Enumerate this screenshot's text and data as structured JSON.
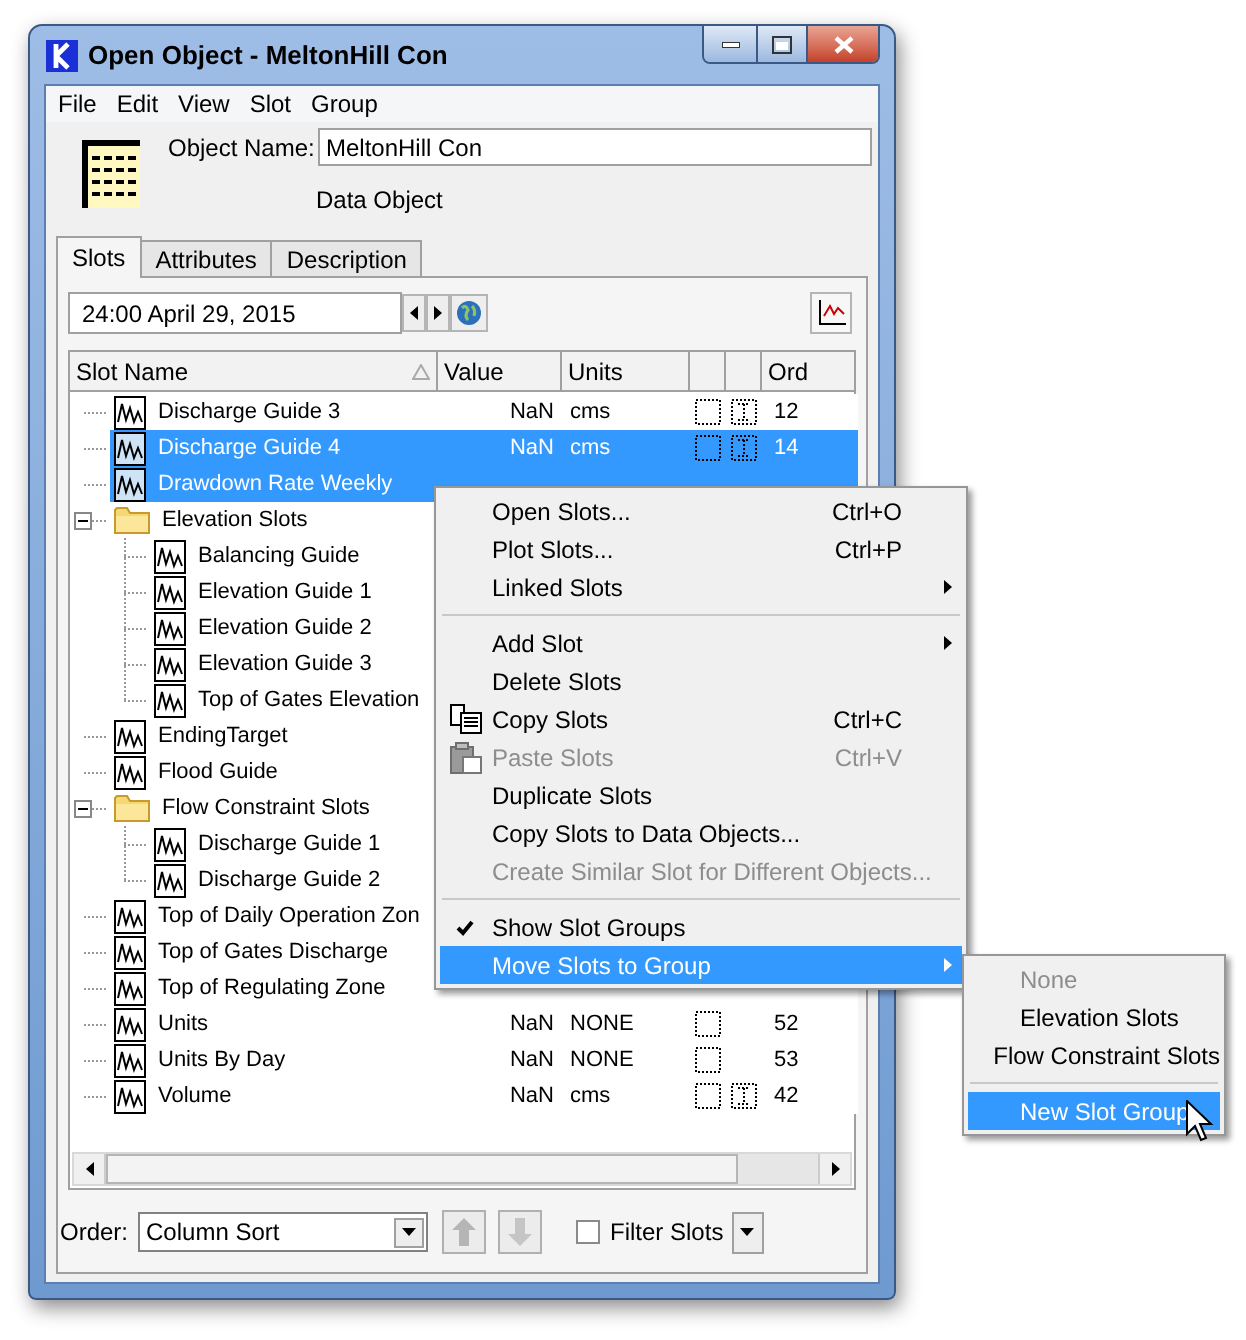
{
  "window": {
    "title": "Open Object - MeltonHill Con"
  },
  "menu_bar": [
    "File",
    "Edit",
    "View",
    "Slot",
    "Group"
  ],
  "object": {
    "name_label": "Object Name:",
    "name_value": "MeltonHill Con",
    "type": "Data Object"
  },
  "tabs": [
    {
      "label": "Slots",
      "selected": true
    },
    {
      "label": "Attributes",
      "selected": false
    },
    {
      "label": "Description",
      "selected": false
    }
  ],
  "timestep": {
    "value": "24:00 April 29, 2015"
  },
  "table": {
    "columns": [
      {
        "label": "Slot Name",
        "sorted": true
      },
      {
        "label": "Value",
        "sorted": false
      },
      {
        "label": "Units",
        "sorted": false
      },
      {
        "label": "Ord",
        "sorted": false
      }
    ],
    "rows": [
      {
        "kind": "slot",
        "name": "Discharge Guide 3",
        "selected": false,
        "value": "NaN",
        "units": "cms",
        "column_4": true,
        "column_5": true,
        "ord": "12"
      },
      {
        "kind": "slot",
        "name": "Discharge Guide 4",
        "selected": true,
        "value": "NaN",
        "units": "cms",
        "column_4": true,
        "column_5": true,
        "ord": "14"
      },
      {
        "kind": "slot",
        "name": "Drawdown Rate Weekly",
        "selected": true
      },
      {
        "kind": "folder",
        "name": "Elevation Slots",
        "selected": false,
        "expanded": true,
        "children": [
          {
            "kind": "slot",
            "name": "Balancing Guide",
            "selected": false
          },
          {
            "kind": "slot",
            "name": "Elevation Guide 1",
            "selected": false
          },
          {
            "kind": "slot",
            "name": "Elevation Guide 2",
            "selected": false
          },
          {
            "kind": "slot",
            "name": "Elevation Guide 3",
            "selected": false
          },
          {
            "kind": "slot",
            "name": "Top of Gates Elevation",
            "selected": false
          }
        ]
      },
      {
        "kind": "slot",
        "name": "EndingTarget",
        "selected": false
      },
      {
        "kind": "slot",
        "name": "Flood Guide",
        "selected": false
      },
      {
        "kind": "folder",
        "name": "Flow Constraint Slots",
        "selected": false,
        "expanded": true,
        "children": [
          {
            "kind": "slot",
            "name": "Discharge Guide 1",
            "selected": false
          },
          {
            "kind": "slot",
            "name": "Discharge Guide 2",
            "selected": false
          }
        ]
      },
      {
        "kind": "slot",
        "name": "Top of Daily Operation Zon",
        "selected": false
      },
      {
        "kind": "slot",
        "name": "Top of Gates Discharge",
        "selected": false
      },
      {
        "kind": "slot",
        "name": "Top of Regulating Zone",
        "selected": false
      },
      {
        "kind": "slot",
        "name": "Units",
        "selected": false,
        "value": "NaN",
        "units": "NONE",
        "column_4": true,
        "column_5": false,
        "ord": "52"
      },
      {
        "kind": "slot",
        "name": "Units By Day",
        "selected": false,
        "value": "NaN",
        "units": "NONE",
        "column_4": true,
        "column_5": false,
        "ord": "53"
      },
      {
        "kind": "slot",
        "name": "Volume",
        "selected": false,
        "value": "NaN",
        "units": "cms",
        "column_4": true,
        "column_5": true,
        "ord": "42"
      }
    ]
  },
  "context_menu": {
    "items": [
      {
        "kind": "item",
        "label": "Open Slots...",
        "shortcut": "Ctrl+O",
        "disabled": false,
        "submenu": false,
        "checked": false,
        "selected": false
      },
      {
        "kind": "item",
        "label": "Plot Slots...",
        "shortcut": "Ctrl+P",
        "disabled": false,
        "submenu": false,
        "checked": false,
        "selected": false
      },
      {
        "kind": "item",
        "label": "Linked Slots",
        "disabled": false,
        "submenu": true,
        "checked": false,
        "selected": false
      },
      {
        "kind": "separator"
      },
      {
        "kind": "item",
        "label": "Add Slot",
        "disabled": false,
        "submenu": true,
        "checked": false,
        "selected": false
      },
      {
        "kind": "item",
        "label": "Delete Slots",
        "disabled": false,
        "submenu": false,
        "checked": false,
        "selected": false
      },
      {
        "kind": "copy",
        "label": "Copy Slots",
        "shortcut": "Ctrl+C",
        "disabled": false,
        "submenu": false,
        "checked": false,
        "selected": false
      },
      {
        "kind": "paste",
        "label": "Paste Slots",
        "shortcut": "Ctrl+V",
        "disabled": true,
        "submenu": false,
        "checked": false,
        "selected": false
      },
      {
        "kind": "item",
        "label": "Duplicate Slots",
        "disabled": false,
        "submenu": false,
        "checked": false,
        "selected": false
      },
      {
        "kind": "item",
        "label": "Copy Slots to Data Objects...",
        "disabled": false,
        "submenu": false,
        "checked": false,
        "selected": false
      },
      {
        "kind": "item",
        "label": "Create Similar Slot for Different Objects...",
        "disabled": true,
        "submenu": false,
        "checked": false,
        "selected": false
      },
      {
        "kind": "separator"
      },
      {
        "kind": "item",
        "label": "Show Slot Groups",
        "disabled": false,
        "submenu": false,
        "checked": true,
        "selected": false
      },
      {
        "kind": "item",
        "label": "Move Slots to Group",
        "disabled": false,
        "submenu": true,
        "checked": false,
        "selected": true
      }
    ]
  },
  "submenu": {
    "items": [
      {
        "kind": "item",
        "label": "None",
        "disabled": true,
        "selected": false
      },
      {
        "kind": "item",
        "label": "Elevation Slots",
        "disabled": false,
        "selected": false
      },
      {
        "kind": "item",
        "label": "Flow Constraint Slots",
        "disabled": false,
        "selected": false
      },
      {
        "kind": "separator"
      },
      {
        "kind": "item",
        "label": "New Slot Group",
        "disabled": false,
        "selected": true
      }
    ]
  },
  "footer": {
    "order_label": "Order:",
    "order_value": "Column Sort",
    "filter": {
      "label": "Filter Slots",
      "checked": false
    }
  }
}
